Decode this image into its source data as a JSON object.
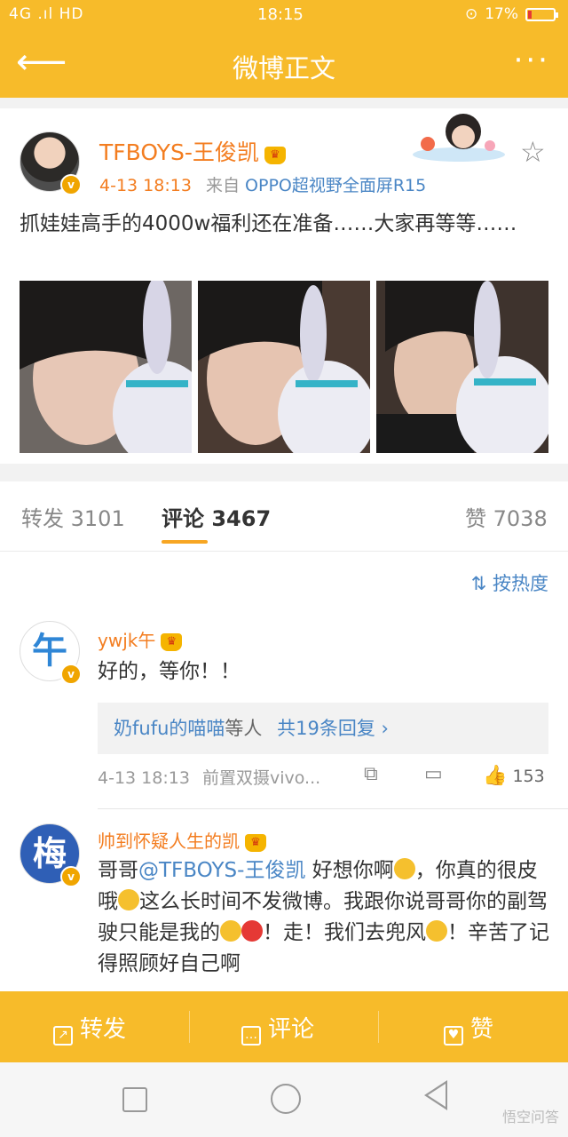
{
  "statusbar": {
    "signal": "4G .ıl HD",
    "time": "18:15",
    "battery": "17%",
    "battery_level": 0.17
  },
  "header": {
    "title": "微博正文",
    "back_icon": "arrow-left-icon",
    "more_icon": "more-dots-icon"
  },
  "post": {
    "author": "TFBOYS-王俊凯",
    "time": "4-13 18:13",
    "source_prefix": "来自",
    "source": "OPPO超视野全面屏R15",
    "text": "抓娃娃高手的4000w福利还在准备……大家再等等……"
  },
  "tabs": {
    "repost_label": "转发",
    "repost_count": "3101",
    "comment_label": "评论",
    "comment_count": "3467",
    "like_label": "赞",
    "like_count": "7038"
  },
  "sort_label": "按热度",
  "comments": [
    {
      "name": "ywjk午",
      "avatar_char": "午",
      "text": "好的，等你！！",
      "reply_names": "奶fufu的喵喵",
      "reply_suffix": "等人",
      "reply_count_text": "共19条回复 ›",
      "time": "4-13 18:13",
      "source": "前置双摄vivo...",
      "likes": "153"
    },
    {
      "name": "帅到怀疑人生的凯",
      "avatar_char": "梅",
      "text_prefix": "哥哥",
      "mention": "@TFBOYS-王俊凯",
      "text_1": " 好想你啊",
      "text_2": "，你真的很皮哦",
      "text_3": "这么长时间不发微博。我跟你说哥哥你的副驾驶只能是我的",
      "text_4": "！走！我们去兜风",
      "text_5": "！辛苦了记得照顾好自己啊"
    }
  ],
  "actionbar": {
    "repost": "转发",
    "comment": "评论",
    "like": "赞"
  },
  "watermark": "悟空问答",
  "colors": {
    "brand": "#f7bb2a",
    "name": "#f37d20",
    "link": "#4a86c5"
  }
}
